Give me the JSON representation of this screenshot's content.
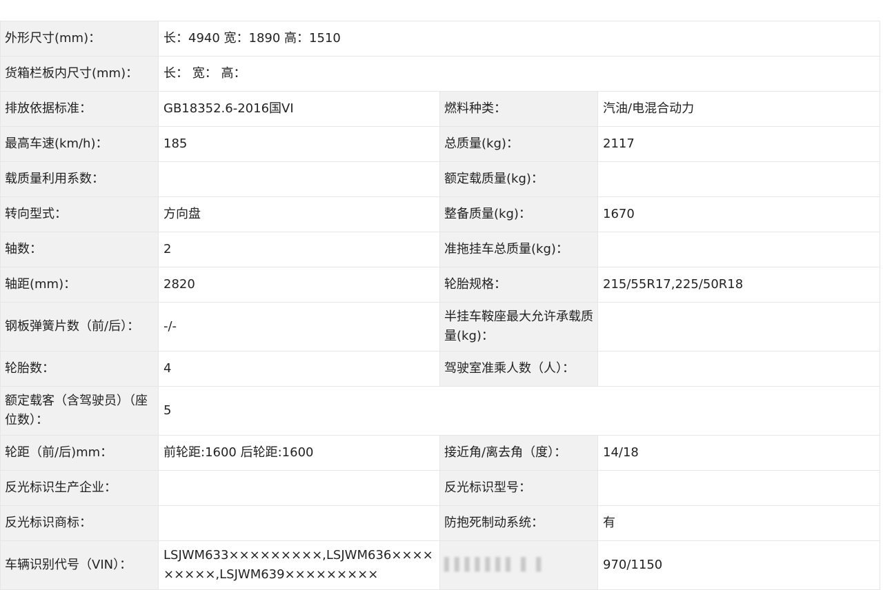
{
  "rows": [
    {
      "label": "外形尺寸(mm)：",
      "value": "长：4940 宽：1890 高：1510"
    },
    {
      "label": "货箱栏板内尺寸(mm)：",
      "value": "长： 宽： 高："
    },
    {
      "label": "排放依据标准：",
      "value": "GB18352.6-2016国VI",
      "label2": "燃料种类：",
      "value2": "汽油/电混合动力"
    },
    {
      "label": "最高车速(km/h)：",
      "value": "185",
      "label2": "总质量(kg)：",
      "value2": "2117"
    },
    {
      "label": "载质量利用系数：",
      "value": "",
      "label2": "额定载质量(kg)：",
      "value2": ""
    },
    {
      "label": "转向型式：",
      "value": "方向盘",
      "label2": "整备质量(kg)：",
      "value2": "1670"
    },
    {
      "label": "轴数：",
      "value": "2",
      "label2": "准拖挂车总质量(kg)：",
      "value2": ""
    },
    {
      "label": "轴距(mm)：",
      "value": "2820",
      "label2": "轮胎规格：",
      "value2": "215/55R17,225/50R18"
    },
    {
      "label": "钢板弹簧片数（前/后）：",
      "value": "-/-",
      "label2": "半挂车鞍座最大允许承载质量(kg)：",
      "value2": ""
    },
    {
      "label": "轮胎数：",
      "value": "4",
      "label2": "驾驶室准乘人数（人）：",
      "value2": ""
    },
    {
      "label": "额定载客（含驾驶员）（座位数）：",
      "value": "5"
    },
    {
      "label": "轮距（前/后)mm：",
      "value": "前轮距:1600 后轮距:1600",
      "label2": "接近角/离去角（度）：",
      "value2": "14/18"
    },
    {
      "label": "反光标识生产企业：",
      "value": "",
      "label2": "反光标识型号：",
      "value2": ""
    },
    {
      "label": "反光标识商标：",
      "value": "",
      "label2": "防抱死制动系统：",
      "value2": "有"
    },
    {
      "label": "车辆识别代号（VIN）：",
      "value": "LSJWM633×××××××××,LSJWM636×××××××××,LSJWM639×××××××××",
      "label2": "▌▌▌▌▌▌▌ ▌ ▌",
      "value2": "970/1150"
    }
  ]
}
